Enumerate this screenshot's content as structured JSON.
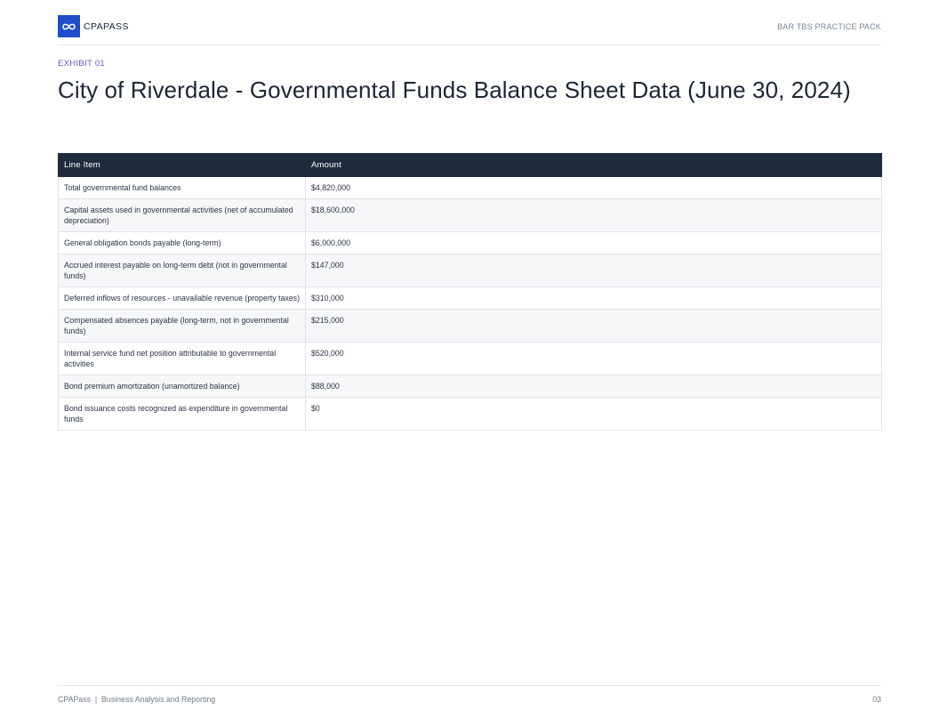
{
  "header": {
    "brand": "CPAPASS",
    "pack_label": "BAR TBS PRACTICE PACK",
    "logo_icon": "infinity-icon",
    "brand_color": "#1f4fc7"
  },
  "exhibit_label": "EXHIBIT 01",
  "title": "City of Riverdale - Governmental Funds Balance Sheet Data (June 30, 2024)",
  "table": {
    "columns": [
      "Line Item",
      "Amount"
    ],
    "rows": [
      [
        "Total governmental fund balances",
        "$4,820,000"
      ],
      [
        "Capital assets used in governmental activities (net of accumulated depreciation)",
        "$18,600,000"
      ],
      [
        "General obligation bonds payable (long-term)",
        "$6,000,000"
      ],
      [
        "Accrued interest payable on long-term debt (not in governmental funds)",
        "$147,000"
      ],
      [
        "Deferred inflows of resources - unavailable revenue (property taxes)",
        "$310,000"
      ],
      [
        "Compensated absences payable (long-term, not in governmental funds)",
        "$215,000"
      ],
      [
        "Internal service fund net position attributable to governmental activities",
        "$520,000"
      ],
      [
        "Bond premium amortization (unamortized balance)",
        "$88,000"
      ],
      [
        "Bond issuance costs recognized as expenditure in governmental funds",
        "$0"
      ]
    ]
  },
  "footer": {
    "left": "CPAPass  |  Business Analysis and Reporting",
    "page_number": "03"
  }
}
